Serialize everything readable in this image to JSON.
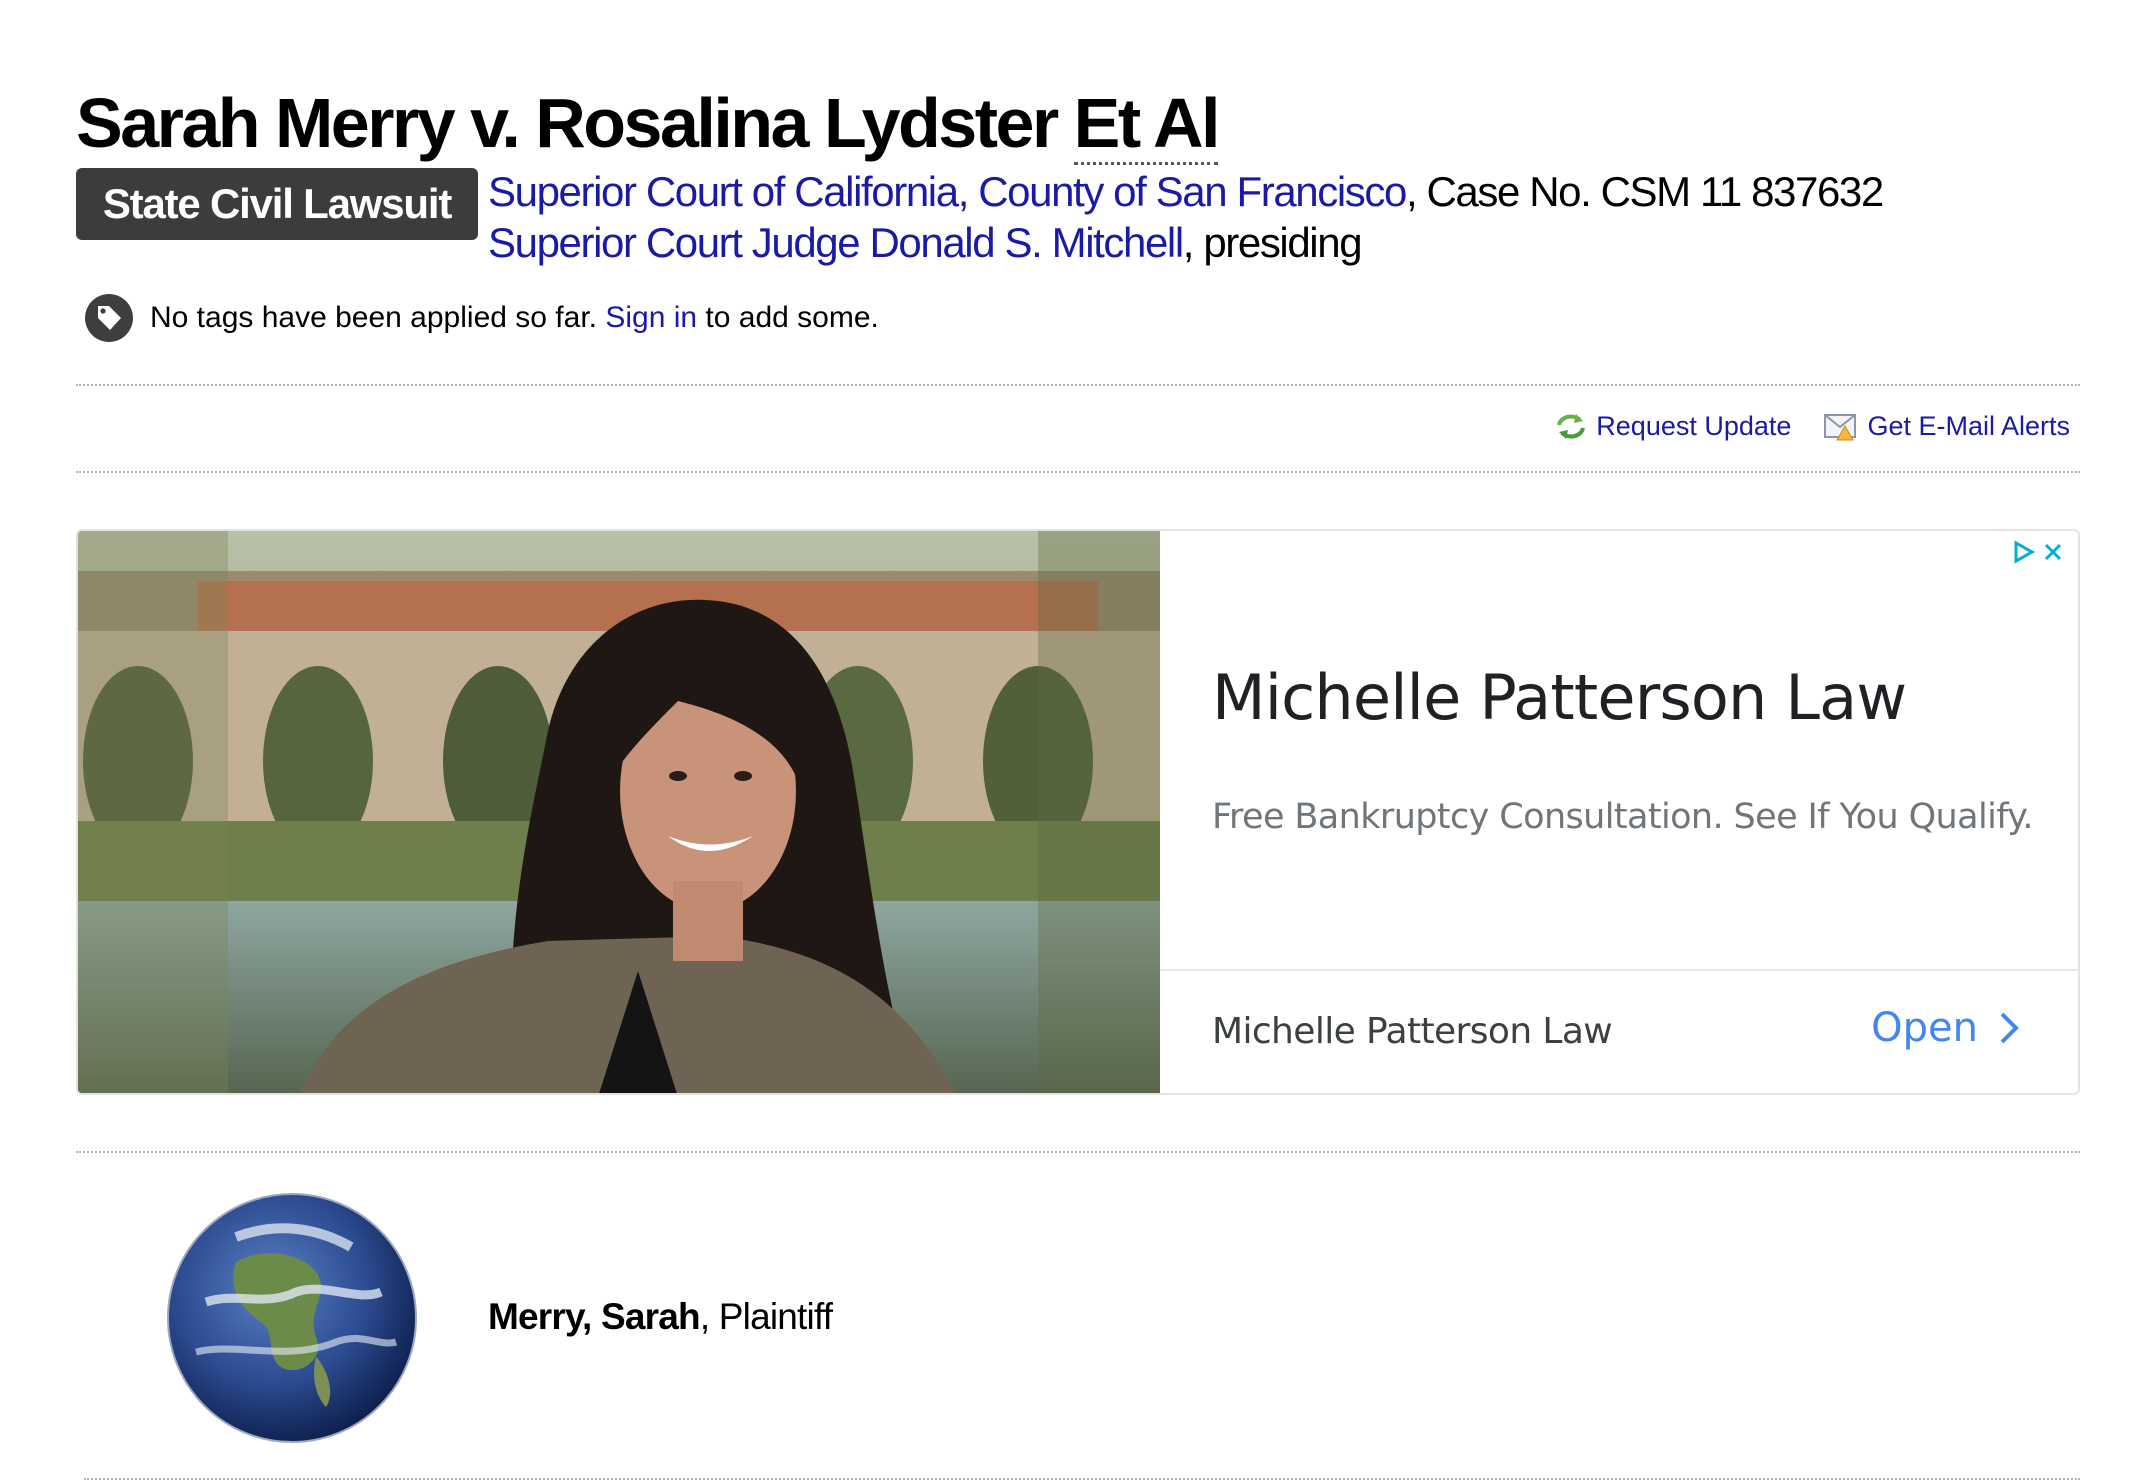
{
  "case": {
    "title_main": "Sarah Merry v. Rosalina Lydster",
    "title_abbr": "Et Al",
    "type_badge": "State Civil Lawsuit",
    "court_link": "Superior Court of California, County of San Francisco",
    "case_number_text": ", Case No. CSM 11 837632",
    "judge_link": "Superior Court Judge Donald S. Mitchell",
    "presiding_text": ", presiding"
  },
  "tags": {
    "icon": "tag-icon",
    "prefix": "No tags have been applied so far.",
    "sign_in_link": "Sign in",
    "suffix": "to add some."
  },
  "actions": {
    "request_update": "Request Update",
    "email_alerts": "Get E-Mail Alerts"
  },
  "ad": {
    "headline": "Michelle Patterson Law",
    "description": "Free Bankruptcy Consultation. See If You Qualify.",
    "advertiser": "Michelle Patterson Law",
    "cta": "Open",
    "colors": {
      "cta": "#4285f4",
      "adchoices": "#00aecd"
    }
  },
  "parties": [
    {
      "name": "Merry, Sarah",
      "role": ", Plaintiff",
      "image": "earth-globe-image"
    }
  ],
  "colors": {
    "link": "#1a1aa6",
    "badge_bg": "#3c3c3c"
  }
}
